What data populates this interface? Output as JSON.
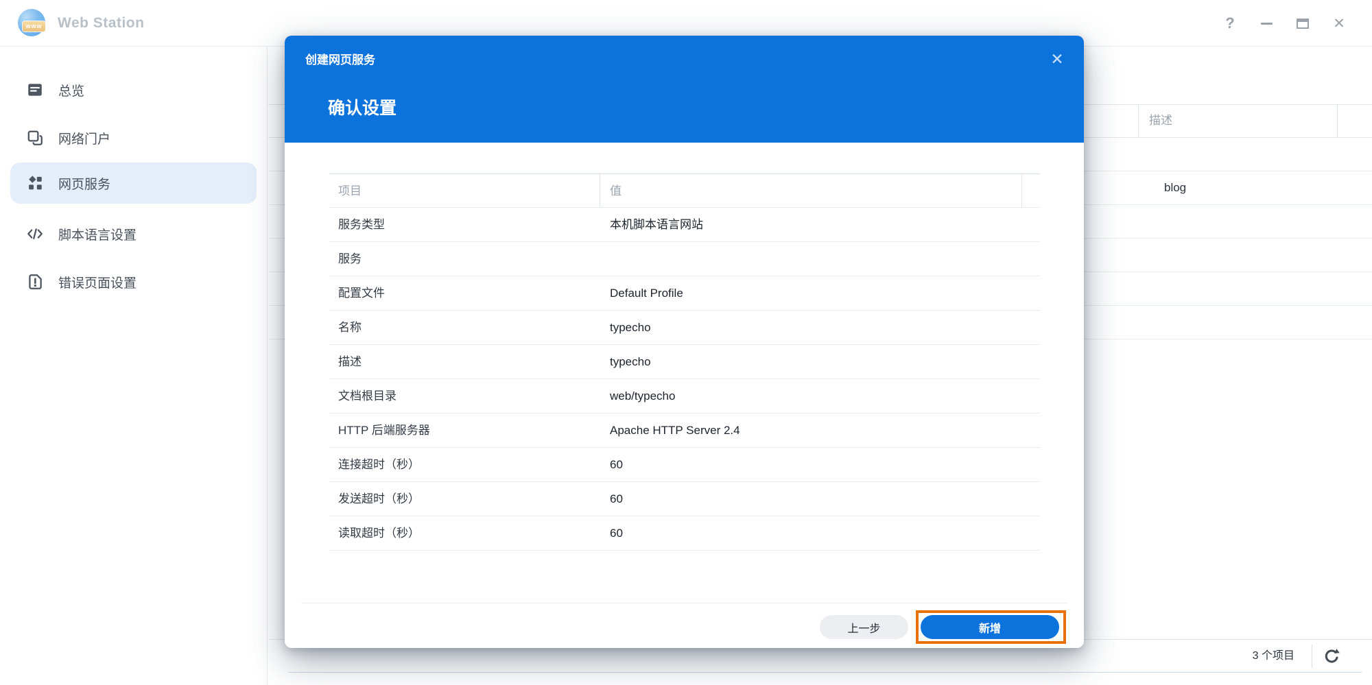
{
  "app": {
    "title": "Web Station"
  },
  "window_controls": {
    "help_icon": "?",
    "close_icon": "✕"
  },
  "sidebar": {
    "items": [
      {
        "label": "总览",
        "icon": "overview-icon",
        "selected": false
      },
      {
        "label": "网络门户",
        "icon": "web-portal-icon",
        "selected": false
      },
      {
        "label": "网页服务",
        "icon": "web-service-icon",
        "selected": true
      },
      {
        "label": "脚本语言设置",
        "icon": "script-language-icon",
        "selected": false
      },
      {
        "label": "错误页面设置",
        "icon": "error-page-icon",
        "selected": false
      }
    ]
  },
  "background": {
    "table": {
      "column_header": "描述",
      "visible_cell": "blog"
    },
    "statusbar": {
      "items_count": "3 个项目",
      "refresh_icon": "clockwise-refresh-arrow"
    }
  },
  "modal": {
    "title": "创建网页服务",
    "subtitle": "确认设置",
    "close_icon": "✕",
    "table": {
      "headers": {
        "item": "项目",
        "value": "值"
      },
      "rows": [
        {
          "label": "服务类型",
          "value": "本机脚本语言网站"
        },
        {
          "label": "服务",
          "value": ""
        },
        {
          "label": "配置文件",
          "value": "Default Profile"
        },
        {
          "label": "名称",
          "value": "typecho"
        },
        {
          "label": "描述",
          "value": "typecho"
        },
        {
          "label": "文档根目录",
          "value": "web/typecho"
        },
        {
          "label": "HTTP 后端服务器",
          "value": "Apache HTTP Server 2.4"
        },
        {
          "label": "连接超时（秒）",
          "value": "60"
        },
        {
          "label": "发送超时（秒）",
          "value": "60"
        },
        {
          "label": "读取超时（秒）",
          "value": "60"
        }
      ]
    },
    "footer": {
      "back_label": "上一步",
      "add_label": "新增"
    }
  },
  "colors": {
    "primary_blue": "#0d73dc",
    "highlight_orange": "#e8710a",
    "selected_item_bg": "#e4eefa"
  }
}
